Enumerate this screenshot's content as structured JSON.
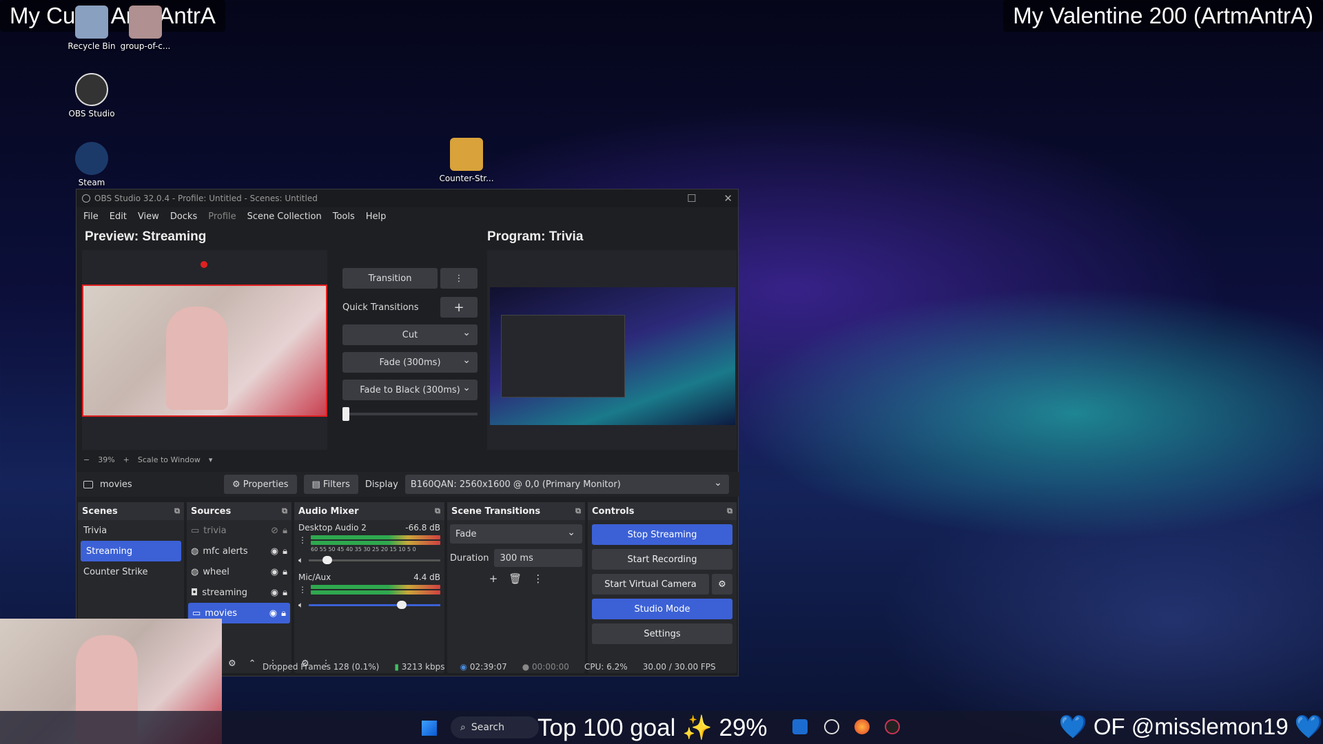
{
  "overlay": {
    "top_left": "My Cupid ArtmAntrA",
    "top_right": "My Valentine 200 (ArtmAntrA)",
    "bottom_center": "Top 100 goal ✨ 29%",
    "bottom_right": "💙 OF @misslemon19 💙"
  },
  "desktop": {
    "icons": [
      "Recycle Bin",
      "group-of-c...",
      "OBS Studio",
      "Steam",
      "Counter-Str..."
    ]
  },
  "obs": {
    "title": "OBS Studio 32.0.4 - Profile: Untitled - Scenes: Untitled",
    "menu": [
      "File",
      "Edit",
      "View",
      "Docks",
      "Profile",
      "Scene Collection",
      "Tools",
      "Help"
    ],
    "preview_title": "Preview: Streaming",
    "program_title": "Program: Trivia",
    "transition_button": "Transition",
    "quick_transitions_label": "Quick Transitions",
    "quick_transitions": [
      "Cut",
      "Fade (300ms)",
      "Fade to Black (300ms)"
    ],
    "zoom": {
      "minus": "−",
      "value": "39%",
      "plus": "+",
      "mode": "Scale to Window"
    },
    "source_bar": {
      "source": "movies",
      "properties": "Properties",
      "filters": "Filters",
      "display_label": "Display",
      "display_value": "B160QAN: 2560x1600 @ 0,0 (Primary Monitor)"
    },
    "scenes": {
      "title": "Scenes",
      "items": [
        "Trivia",
        "Streaming",
        "Counter Strike"
      ],
      "selected": "Streaming"
    },
    "sources": {
      "title": "Sources",
      "items": [
        "trivia",
        "mfc alerts",
        "wheel",
        "streaming",
        "movies"
      ]
    },
    "audio": {
      "title": "Audio Mixer",
      "channels": [
        {
          "name": "Desktop Audio 2",
          "db": "-66.8 dB",
          "scale": "60 55 50 45 40 35 30 25 20 15 10 5 0"
        },
        {
          "name": "Mic/Aux",
          "db": "4.4 dB"
        }
      ]
    },
    "transitions": {
      "title": "Scene Transitions",
      "selected": "Fade",
      "duration_label": "Duration",
      "duration_value": "300 ms"
    },
    "controls": {
      "title": "Controls",
      "buttons": [
        "Stop Streaming",
        "Start Recording",
        "Start Virtual Camera",
        "Studio Mode",
        "Settings"
      ]
    },
    "status": {
      "dropped": "Dropped Frames 128 (0.1%)",
      "bitrate": "3213 kbps",
      "stream_time": "02:39:07",
      "rec_time": "00:00:00",
      "cpu": "CPU: 6.2%",
      "fps": "30.00 / 30.00 FPS"
    }
  },
  "taskbar": {
    "search": "Search"
  }
}
